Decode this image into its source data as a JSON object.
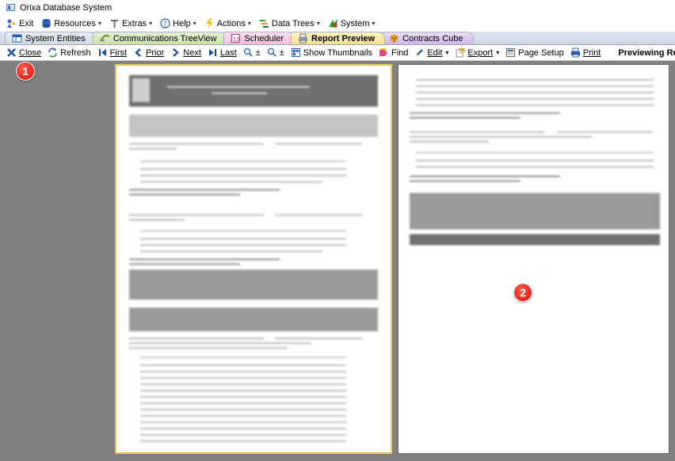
{
  "window": {
    "title": "Orixa Database System"
  },
  "menu": {
    "exit": "Exit",
    "resources": "Resources",
    "extras": "Extras",
    "help": "Help",
    "actions": "Actions",
    "data_trees": "Data Trees",
    "system": "System"
  },
  "tabs": [
    {
      "label": "System Entities"
    },
    {
      "label": "Communications TreeView"
    },
    {
      "label": "Scheduler"
    },
    {
      "label": "Report Preview"
    },
    {
      "label": "Contracts Cube"
    }
  ],
  "toolbar": {
    "close": "Close",
    "refresh": "Refresh",
    "first": "First",
    "prior": "Prior",
    "next": "Next",
    "last": "Last",
    "zoom_in": "±",
    "zoom_out": "±",
    "show_thumbnails": "Show Thumbnails",
    "find": "Find",
    "edit": "Edit",
    "export": "Export",
    "page_setup": "Page Setup",
    "print": "Print",
    "previewing": "Previewing Report: \"Custor"
  },
  "annotations": {
    "badge1": "1",
    "badge2": "2"
  },
  "colors": {
    "workspace": "#808080",
    "selected_page_border": "#e6c25a",
    "badge": "#d4140c",
    "tab_report_preview": "#f4e08a"
  }
}
